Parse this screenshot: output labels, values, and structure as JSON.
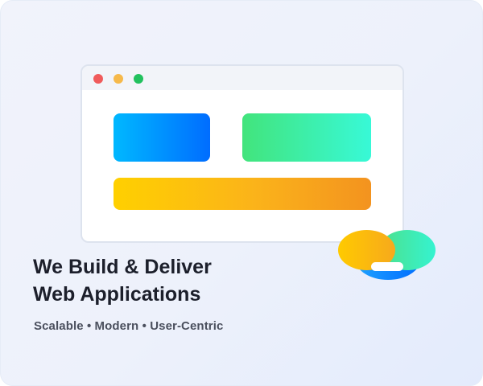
{
  "hero": {
    "headline_line1": "We Build & Deliver",
    "headline_line2": "Web Applications",
    "tagline": "Scalable • Modern • User-Centric"
  },
  "illustration": {
    "window_controls": [
      "close",
      "minimize",
      "maximize"
    ],
    "colors": {
      "close": "#f05b5b",
      "minimize": "#f6b94a",
      "maximize": "#22c15e",
      "blue_gradient": [
        "#00b8ff",
        "#006dff"
      ],
      "green_gradient": [
        "#42e47c",
        "#38f9d7"
      ],
      "orange_gradient": [
        "#ffd000",
        "#f3931f"
      ]
    }
  },
  "theme": {
    "background": "#edf1fb",
    "text_primary": "#1c1f2b",
    "text_secondary": "#4b505e"
  }
}
